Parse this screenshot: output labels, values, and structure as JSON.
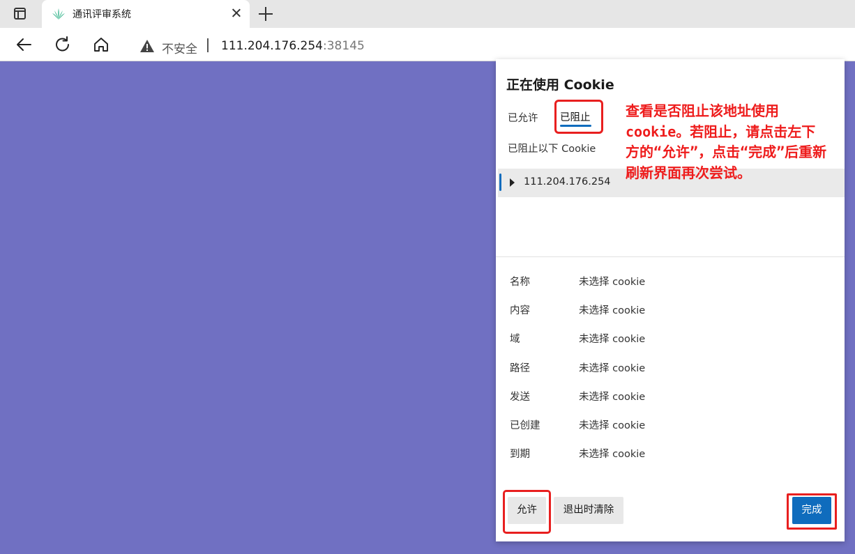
{
  "browser": {
    "tab_title": "通讯评审系统",
    "address": {
      "security_label": "不安全",
      "host": "111.204.176.254",
      "port": ":38145"
    }
  },
  "cookie_panel": {
    "title": "正在使用 Cookie",
    "tabs": {
      "allowed": "已允许",
      "blocked": "已阻止"
    },
    "active_tab": "已阻止",
    "blocked_heading": "已阻止以下 Cookie",
    "sites": [
      "111.204.176.254"
    ],
    "details": [
      {
        "key": "名称",
        "value": "未选择 cookie"
      },
      {
        "key": "内容",
        "value": "未选择 cookie"
      },
      {
        "key": "域",
        "value": "未选择 cookie"
      },
      {
        "key": "路径",
        "value": "未选择 cookie"
      },
      {
        "key": "发送",
        "value": "未选择 cookie"
      },
      {
        "key": "已创建",
        "value": "未选择 cookie"
      },
      {
        "key": "到期",
        "value": "未选择 cookie"
      }
    ],
    "buttons": {
      "allow": "允许",
      "clear_on_exit": "退出时清除",
      "done": "完成"
    }
  },
  "annotation": {
    "text": "查看是否阻止该地址使用cookie。若阻止，请点击左下方的“允许”，点击“完成”后重新刷新界面再次尝试。",
    "color": "#e81f1f"
  },
  "colors": {
    "page_background": "#7070c2",
    "accent": "#0f6cbd"
  },
  "icons": [
    "tab-actions-icon",
    "plant-favicon-icon",
    "close-icon",
    "plus-icon",
    "back-arrow-icon",
    "refresh-icon",
    "home-icon",
    "warning-icon",
    "caret-right-icon"
  ]
}
